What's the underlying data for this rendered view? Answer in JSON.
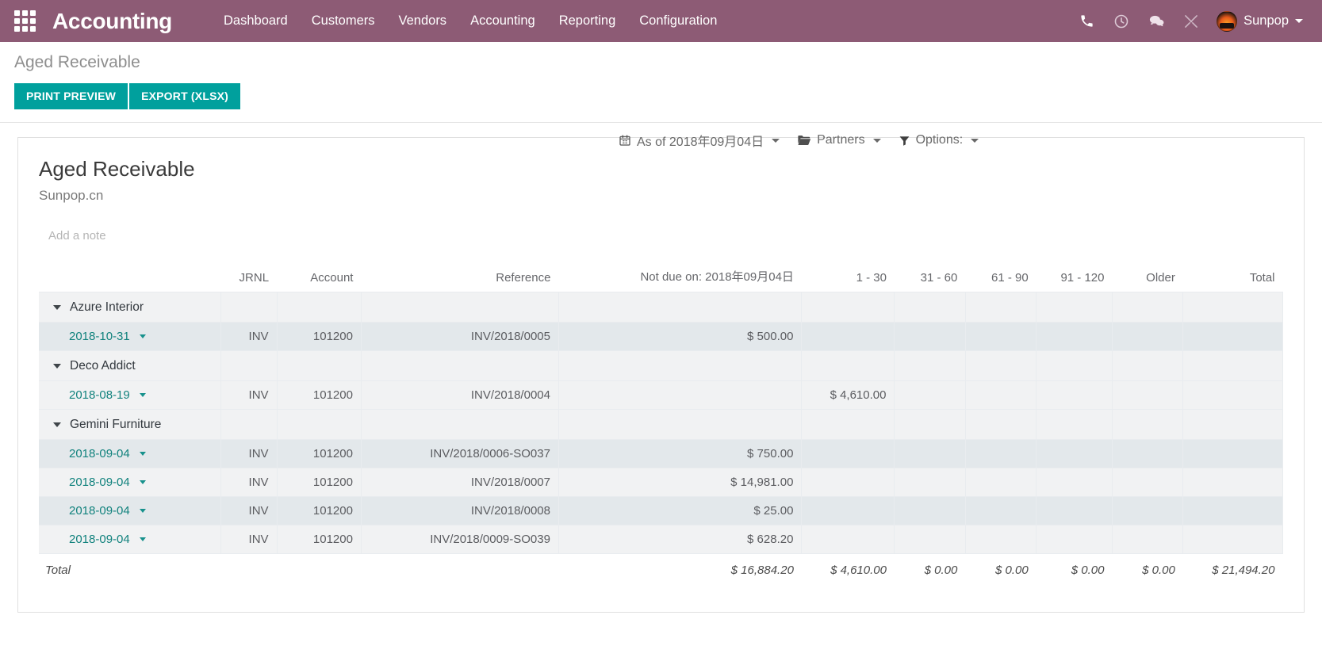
{
  "navbar": {
    "apps_icon": "apps-grid-icon",
    "brand": "Accounting",
    "menus": [
      {
        "label": "Dashboard"
      },
      {
        "label": "Customers"
      },
      {
        "label": "Vendors"
      },
      {
        "label": "Accounting"
      },
      {
        "label": "Reporting"
      },
      {
        "label": "Configuration"
      }
    ],
    "icons": [
      {
        "name": "phone-icon"
      },
      {
        "name": "clock-icon"
      },
      {
        "name": "chat-icon"
      },
      {
        "name": "tools-icon"
      }
    ],
    "user": {
      "name": "Sunpop",
      "avatar": "user-avatar"
    },
    "bg_color": "#8d5b75"
  },
  "control_panel": {
    "breadcrumb": "Aged Receivable",
    "print_preview_label": "PRINT PREVIEW",
    "export_label": "EXPORT (XLSX)",
    "button_color": "#00a09d",
    "filters": [
      {
        "name": "date-filter",
        "icon": "calendar-icon",
        "label": "As of 2018年09月04日"
      },
      {
        "name": "partners-filter",
        "icon": "folder-icon",
        "label": "Partners"
      },
      {
        "name": "options-filter",
        "icon": "funnel-icon",
        "label": "Options:"
      }
    ]
  },
  "report": {
    "title": "Aged Receivable",
    "company": "Sunpop.cn",
    "note_placeholder": "Add a note",
    "columns": {
      "name": "",
      "jrnl": "JRNL",
      "account": "Account",
      "reference": "Reference",
      "not_due": "Not due on: 2018年09月04日",
      "b1": "1 - 30",
      "b2": "31 - 60",
      "b3": "61 - 90",
      "b4": "91 - 120",
      "b5": "Older",
      "total": "Total"
    },
    "groups": [
      {
        "partner": "Azure Interior",
        "lines": [
          {
            "date": "2018-10-31",
            "jrnl": "INV",
            "account": "101200",
            "reference": "INV/2018/0005",
            "not_due": "$ 500.00",
            "b1": "",
            "b2": "",
            "b3": "",
            "b4": "",
            "b5": "",
            "total": ""
          }
        ]
      },
      {
        "partner": "Deco Addict",
        "lines": [
          {
            "date": "2018-08-19",
            "jrnl": "INV",
            "account": "101200",
            "reference": "INV/2018/0004",
            "not_due": "",
            "b1": "$ 4,610.00",
            "b2": "",
            "b3": "",
            "b4": "",
            "b5": "",
            "total": ""
          }
        ]
      },
      {
        "partner": "Gemini Furniture",
        "lines": [
          {
            "date": "2018-09-04",
            "jrnl": "INV",
            "account": "101200",
            "reference": "INV/2018/0006-SO037",
            "not_due": "$ 750.00",
            "b1": "",
            "b2": "",
            "b3": "",
            "b4": "",
            "b5": "",
            "total": ""
          },
          {
            "date": "2018-09-04",
            "jrnl": "INV",
            "account": "101200",
            "reference": "INV/2018/0007",
            "not_due": "$ 14,981.00",
            "b1": "",
            "b2": "",
            "b3": "",
            "b4": "",
            "b5": "",
            "total": ""
          },
          {
            "date": "2018-09-04",
            "jrnl": "INV",
            "account": "101200",
            "reference": "INV/2018/0008",
            "not_due": "$ 25.00",
            "b1": "",
            "b2": "",
            "b3": "",
            "b4": "",
            "b5": "",
            "total": ""
          },
          {
            "date": "2018-09-04",
            "jrnl": "INV",
            "account": "101200",
            "reference": "INV/2018/0009-SO039",
            "not_due": "$ 628.20",
            "b1": "",
            "b2": "",
            "b3": "",
            "b4": "",
            "b5": "",
            "total": ""
          }
        ]
      }
    ],
    "total_row": {
      "label": "Total",
      "not_due": "$ 16,884.20",
      "b1": "$ 4,610.00",
      "b2": "$ 0.00",
      "b3": "$ 0.00",
      "b4": "$ 0.00",
      "b5": "$ 0.00",
      "total": "$ 21,494.20"
    }
  }
}
